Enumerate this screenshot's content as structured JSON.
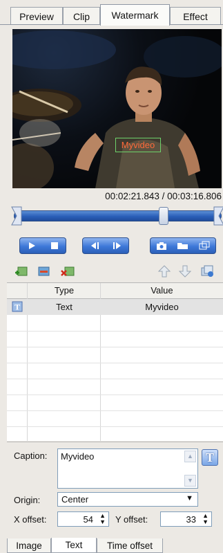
{
  "tabs": [
    "Preview",
    "Clip",
    "Watermark",
    "Effect"
  ],
  "active_tab": "Watermark",
  "video": {
    "watermark_text": "Myvideo"
  },
  "timecode": "00:02:21.843 / 00:03:16.806",
  "seek": {
    "position_fraction": 0.72
  },
  "table": {
    "columns": [
      "Type",
      "Value"
    ],
    "rows": [
      {
        "type": "Text",
        "value": "Myvideo"
      }
    ]
  },
  "caption": {
    "label": "Caption:",
    "value": "Myvideo"
  },
  "origin": {
    "label": "Origin:",
    "value": "Center"
  },
  "x_offset": {
    "label": "X offset:",
    "value": "54"
  },
  "y_offset": {
    "label": "Y offset:",
    "value": "33"
  },
  "bottom_tabs": [
    "Image",
    "Text",
    "Time offset"
  ],
  "active_bottom_tab": "Text"
}
